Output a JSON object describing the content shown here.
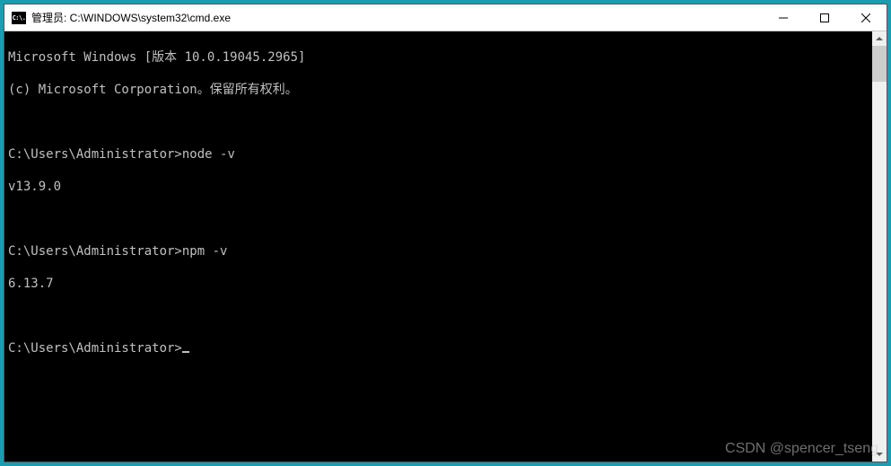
{
  "titlebar": {
    "icon_label": "C:\\.",
    "title": "管理员: C:\\WINDOWS\\system32\\cmd.exe"
  },
  "terminal": {
    "header_line1": "Microsoft Windows [版本 10.0.19045.2965]",
    "header_line2": "(c) Microsoft Corporation。保留所有权利。",
    "prompt": "C:\\Users\\Administrator>",
    "blocks": [
      {
        "command": "node -v",
        "output": "v13.9.0"
      },
      {
        "command": "npm -v",
        "output": "6.13.7"
      }
    ]
  },
  "watermark": "CSDN @spencer_tseng"
}
